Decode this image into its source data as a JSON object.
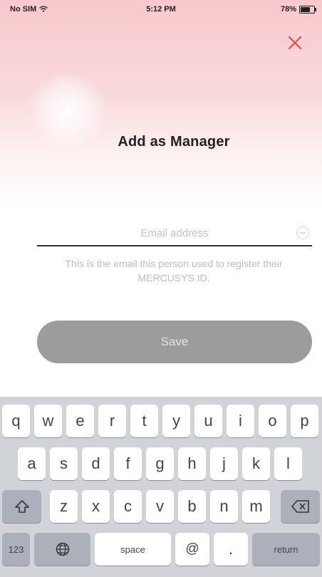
{
  "status_bar": {
    "carrier": "No SIM",
    "time": "5:12 PM",
    "battery": "78%"
  },
  "header": {
    "title": "Add as Manager"
  },
  "form": {
    "email_placeholder": "Email address",
    "email_value": "",
    "helper_text": "This is the email this person used to register their MERCUSYS ID.",
    "save_label": "Save"
  },
  "keyboard": {
    "row1": [
      "q",
      "w",
      "e",
      "r",
      "t",
      "y",
      "u",
      "i",
      "o",
      "p"
    ],
    "row2": [
      "a",
      "s",
      "d",
      "f",
      "g",
      "h",
      "j",
      "k",
      "l"
    ],
    "row3": [
      "z",
      "x",
      "c",
      "v",
      "b",
      "n",
      "m"
    ],
    "bottom": {
      "numbers": "123",
      "space": "space",
      "at": "@",
      "dot": ".",
      "return": "return"
    }
  },
  "colors": {
    "save_button_bg": "#9c9c9c",
    "hero_top": "#f7c9cc",
    "close_icon": "#e64b4b"
  }
}
